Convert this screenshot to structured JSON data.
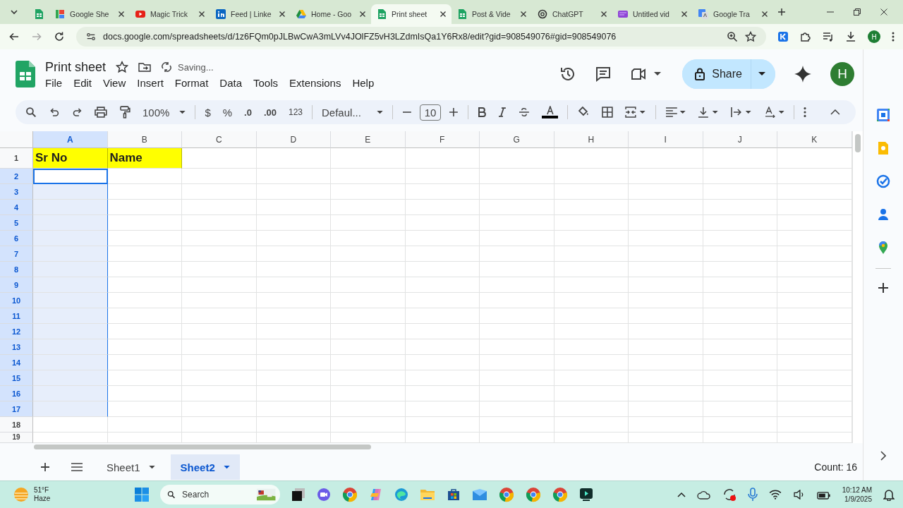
{
  "browser_tabs": [
    {
      "kind": "sheets",
      "selected": false
    },
    {
      "kind": "sites",
      "label": "Google She",
      "selected": false
    },
    {
      "kind": "youtube",
      "label": "Magic Trick",
      "selected": false
    },
    {
      "kind": "linkedin",
      "label": "Feed | Linke",
      "selected": false
    },
    {
      "kind": "drive",
      "label": "Home - Goo",
      "selected": false
    },
    {
      "kind": "sheets",
      "label": "Print sheet",
      "selected": true
    },
    {
      "kind": "sheets",
      "label": "Post & Vide",
      "selected": false
    },
    {
      "kind": "chatgpt",
      "label": "ChatGPT",
      "selected": false
    },
    {
      "kind": "video",
      "label": "Untitled vid",
      "selected": false
    },
    {
      "kind": "translate",
      "label": "Google Tra",
      "selected": false
    }
  ],
  "address_bar": {
    "url": "docs.google.com/spreadsheets/d/1z6FQm0pJLBwCwA3mLVv4JOlFZ5vH3LZdmIsQa1Y6Rx8/edit?gid=908549076#gid=908549076",
    "profile": "H"
  },
  "document": {
    "title": "Print sheet",
    "status": "Saving...",
    "menus": [
      "File",
      "Edit",
      "View",
      "Insert",
      "Format",
      "Data",
      "Tools",
      "Extensions",
      "Help"
    ],
    "share": "Share",
    "avatar": "H"
  },
  "toolbar": {
    "zoom": "100%",
    "currency": "$",
    "percent": "%",
    "decrease_decimals": ".0",
    "increase_decimals": ".00",
    "number_format": "123",
    "font": "Defaul...",
    "font_size": "10"
  },
  "grid": {
    "columns": [
      {
        "label": "A",
        "selected": true
      },
      {
        "label": "B",
        "selected": false
      },
      {
        "label": "C",
        "selected": false
      },
      {
        "label": "D",
        "selected": false
      },
      {
        "label": "E",
        "selected": false
      },
      {
        "label": "F",
        "selected": false
      },
      {
        "label": "G",
        "selected": false
      },
      {
        "label": "H",
        "selected": false
      },
      {
        "label": "I",
        "selected": false
      },
      {
        "label": "J",
        "selected": false
      },
      {
        "label": "K",
        "selected": false
      }
    ],
    "rows": [
      {
        "label": "1",
        "selected": false,
        "active": false,
        "cells": [
          {
            "text": "Sr No",
            "highlighted": true
          },
          {
            "text": "Name",
            "highlighted": true
          }
        ]
      },
      {
        "label": "2",
        "selected": true,
        "active": true
      },
      {
        "label": "3",
        "selected": true,
        "active": false
      },
      {
        "label": "4",
        "selected": true,
        "active": false
      },
      {
        "label": "5",
        "selected": true,
        "active": false
      },
      {
        "label": "6",
        "selected": true,
        "active": false
      },
      {
        "label": "7",
        "selected": true,
        "active": false
      },
      {
        "label": "8",
        "selected": true,
        "active": false
      },
      {
        "label": "9",
        "selected": true,
        "active": false
      },
      {
        "label": "10",
        "selected": true,
        "active": false
      },
      {
        "label": "11",
        "selected": true,
        "active": false
      },
      {
        "label": "12",
        "selected": true,
        "active": false
      },
      {
        "label": "13",
        "selected": true,
        "active": false
      },
      {
        "label": "14",
        "selected": true,
        "active": false
      },
      {
        "label": "15",
        "selected": true,
        "active": false
      },
      {
        "label": "16",
        "selected": true,
        "active": false
      },
      {
        "label": "17",
        "selected": true,
        "active": false
      },
      {
        "label": "18",
        "selected": false,
        "active": false
      },
      {
        "label": "19",
        "selected": false,
        "active": false
      }
    ]
  },
  "sheet_tabs": [
    {
      "label": "Sheet1",
      "selected": false
    },
    {
      "label": "Sheet2",
      "selected": true
    }
  ],
  "status": "Count: 16",
  "taskbar": {
    "temperature": "51°F",
    "weather": "Haze",
    "search_placeholder": "Search",
    "time": "10:12 AM",
    "date": "1/9/2025"
  }
}
